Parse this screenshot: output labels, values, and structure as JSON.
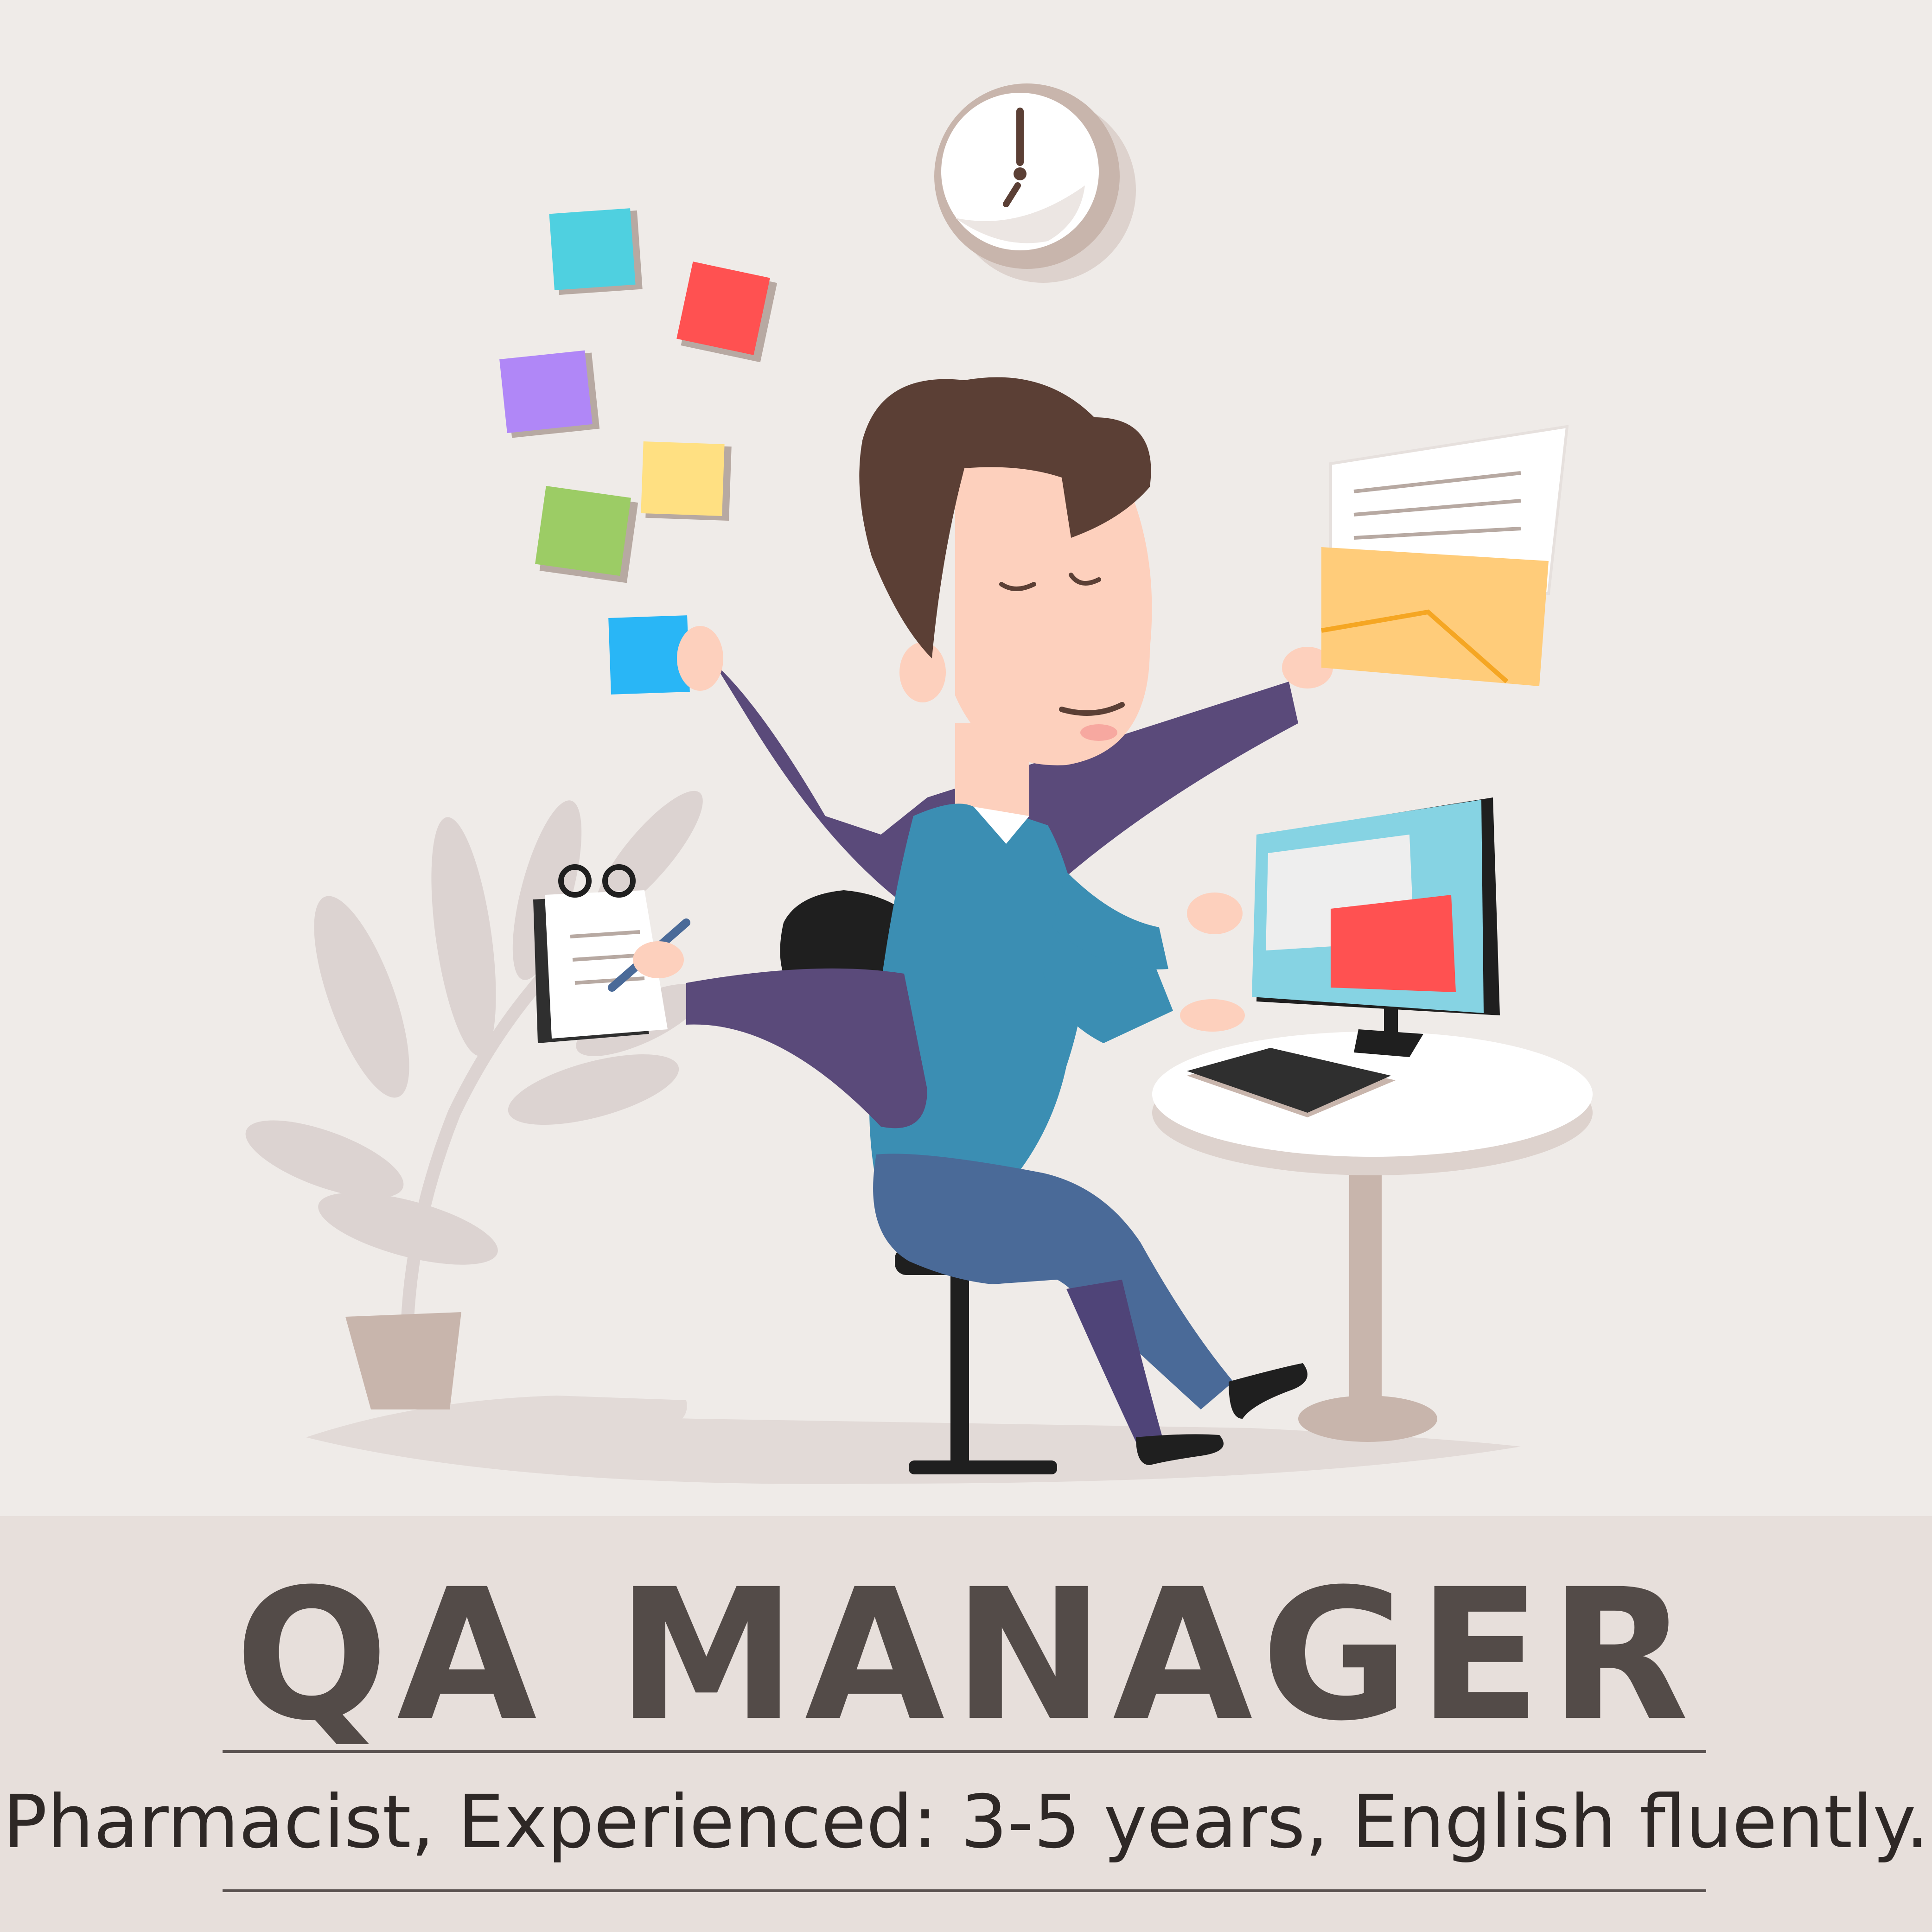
{
  "title": "QA MANAGER",
  "subtitle": "Pharmacist, Experienced: 3-5 years, English fluently.",
  "colors": {
    "background": "#efebe8",
    "banner": "#e7dfdb",
    "title_text": "#534b48",
    "subtitle_text": "#2e2826",
    "suit": "#3b8eb3",
    "suit_dark": "#5a4a7a",
    "hair": "#5b3f35",
    "skin": "#fdd0bd",
    "sticky_cyan": "#4fd0e0",
    "sticky_red": "#ff5151",
    "sticky_purple": "#b087f7",
    "sticky_yellow": "#ffe082",
    "sticky_green": "#9ccc65",
    "sticky_blue": "#29b6f6",
    "envelope": "#ffcc7a",
    "monitor_screen": "#86d3e3",
    "plant": "#dcd3d1"
  },
  "icons": [
    "clock-icon",
    "sticky-note-icon",
    "envelope-icon",
    "notepad-icon",
    "monitor-icon",
    "keyboard-icon",
    "office-chair-icon",
    "potted-plant-icon"
  ]
}
